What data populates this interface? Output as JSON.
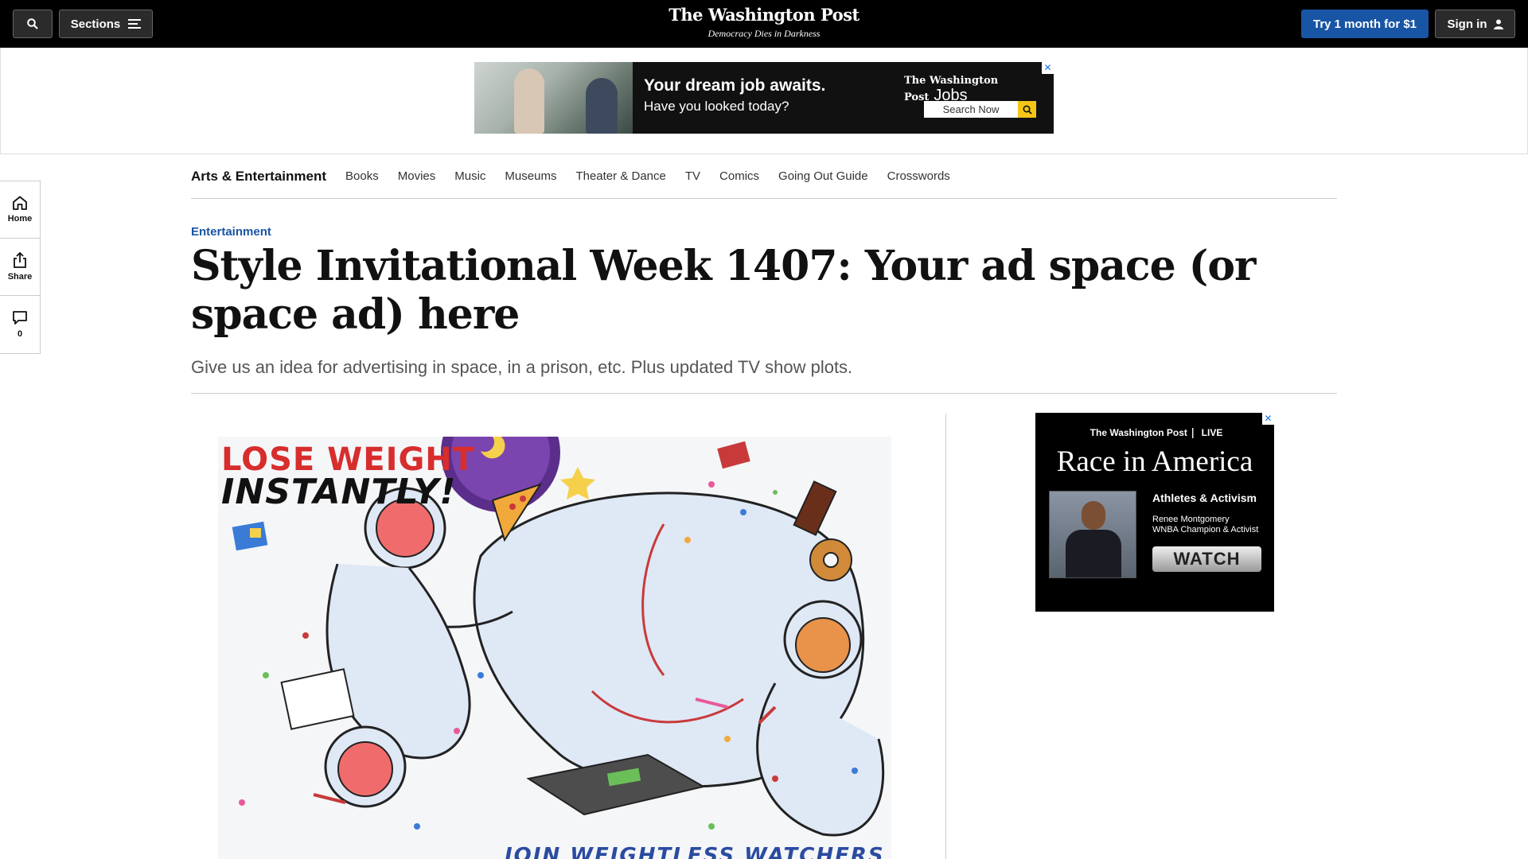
{
  "topbar": {
    "sections_label": "Sections",
    "subscribe_label": "Try 1 month for $1",
    "signin_label": "Sign in",
    "masthead": "The Washington Post",
    "tagline": "Democracy Dies in Darkness"
  },
  "top_ad": {
    "headline": "Your dream job awaits.",
    "subline": "Have you looked today?",
    "brand": "The Washington Post",
    "brand_suffix": "Jobs",
    "search_label": "Search Now"
  },
  "subnav": {
    "section_title": "Arts & Entertainment",
    "items": [
      "Books",
      "Movies",
      "Music",
      "Museums",
      "Theater & Dance",
      "TV",
      "Comics",
      "Going Out Guide",
      "Crosswords"
    ]
  },
  "rail": {
    "home_label": "Home",
    "share_label": "Share",
    "comments_count": "0"
  },
  "article": {
    "kicker": "Entertainment",
    "headline": "Style Invitational Week 1407: Your ad space (or space ad) here",
    "dek": "Give us an idea for advertising in space, in a prison, etc. Plus updated TV show plots."
  },
  "artwork": {
    "title_line1": "LOSE WEIGHT",
    "title_line2": "INSTANTLY!",
    "bottom_text": "JOIN WEIGHTLESS WATCHERS"
  },
  "right_ad": {
    "brand": "The Washington Post",
    "brand_suffix": "LIVE",
    "title": "Race in America",
    "heading": "Athletes & Activism",
    "name": "Renee Montgomery",
    "role": "WNBA Champion & Activist",
    "cta": "WATCH"
  },
  "colors": {
    "accent_blue": "#1955a5",
    "topbar_bg": "#000000",
    "ad_search_yellow": "#f5c518"
  }
}
